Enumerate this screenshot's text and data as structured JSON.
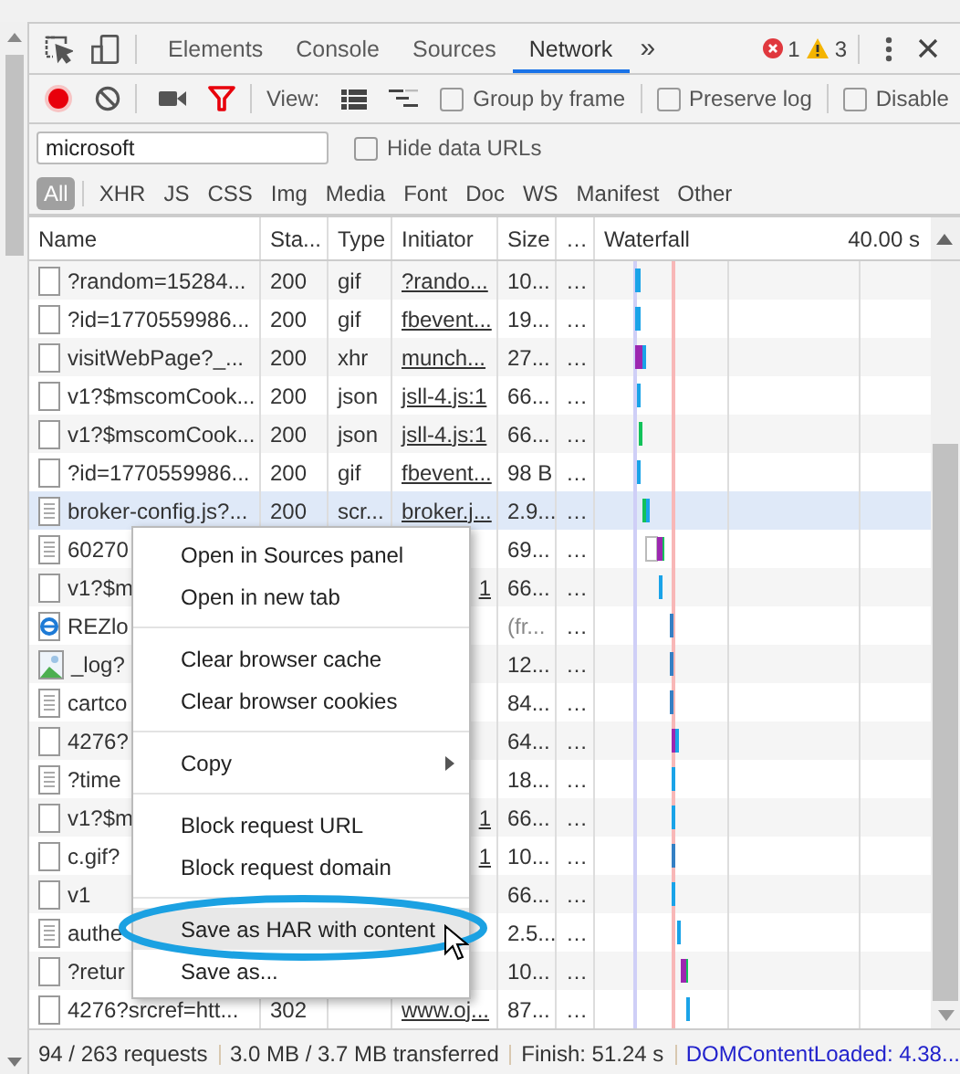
{
  "tabs": [
    {
      "label": "Elements",
      "selected": false
    },
    {
      "label": "Console",
      "selected": false
    },
    {
      "label": "Sources",
      "selected": false
    },
    {
      "label": "Network",
      "selected": true
    }
  ],
  "more_tabs": "»",
  "error_count": "1",
  "warning_count": "3",
  "network_toolbar": {
    "recording": true,
    "filter_active": true,
    "view_label": "View:",
    "checkboxes": [
      {
        "label": "Group by frame",
        "checked": false
      },
      {
        "label": "Preserve log",
        "checked": false
      },
      {
        "label": "Disable",
        "checked": false
      }
    ]
  },
  "filter": {
    "value": "microsoft",
    "hide_data_urls": {
      "label": "Hide data URLs",
      "checked": false
    }
  },
  "type_filters": [
    {
      "label": "All",
      "selected": true
    },
    {
      "label": "XHR",
      "selected": false
    },
    {
      "label": "JS",
      "selected": false
    },
    {
      "label": "CSS",
      "selected": false
    },
    {
      "label": "Img",
      "selected": false
    },
    {
      "label": "Media",
      "selected": false
    },
    {
      "label": "Font",
      "selected": false
    },
    {
      "label": "Doc",
      "selected": false
    },
    {
      "label": "WS",
      "selected": false
    },
    {
      "label": "Manifest",
      "selected": false
    },
    {
      "label": "Other",
      "selected": false
    }
  ],
  "table": {
    "columns": [
      "Name",
      "Sta...",
      "Type",
      "Initiator",
      "Size",
      "…",
      "Waterfall"
    ],
    "timeline_label": "40.00 s",
    "rows": [
      {
        "kind": "blank",
        "name": "?random=15284...",
        "status": "200",
        "type": "gif",
        "initiator": "?rando...",
        "size": "10...",
        "more": "…",
        "selected": false
      },
      {
        "kind": "blank",
        "name": "?id=1770559986...",
        "status": "200",
        "type": "gif",
        "initiator": "fbevent...",
        "size": "19...",
        "more": "…",
        "selected": false
      },
      {
        "kind": "blank",
        "name": "visitWebPage?_...",
        "status": "200",
        "type": "xhr",
        "initiator": "munch...",
        "size": "27...",
        "more": "…",
        "selected": false
      },
      {
        "kind": "blank",
        "name": "v1?$mscomCook...",
        "status": "200",
        "type": "json",
        "initiator": "jsll-4.js:1",
        "size": "66...",
        "more": "…",
        "selected": false
      },
      {
        "kind": "blank",
        "name": "v1?$mscomCook...",
        "status": "200",
        "type": "json",
        "initiator": "jsll-4.js:1",
        "size": "66...",
        "more": "…",
        "selected": false
      },
      {
        "kind": "blank",
        "name": "?id=1770559986...",
        "status": "200",
        "type": "gif",
        "initiator": "fbevent...",
        "size": "98 B",
        "more": "…",
        "selected": false
      },
      {
        "kind": "script",
        "name": "broker-config.js?...",
        "status": "200",
        "type": "scr...",
        "initiator": "broker.j...",
        "size": "2.9...",
        "more": "…",
        "selected": true
      },
      {
        "kind": "script",
        "name": "60270",
        "size": "69...",
        "more": "…",
        "selected": false
      },
      {
        "kind": "blank",
        "name": "v1?$m",
        "initiator": "1",
        "size": "66...",
        "more": "…",
        "selected": false
      },
      {
        "kind": "web",
        "name": "REZlo",
        "size": "(fr...",
        "from_cache": true,
        "more": "…",
        "selected": false
      },
      {
        "kind": "image",
        "name": "_log?",
        "size": "12...",
        "more": "…",
        "selected": false
      },
      {
        "kind": "script",
        "name": "cartco",
        "size": "84...",
        "more": "…",
        "selected": false
      },
      {
        "kind": "blank",
        "name": "4276?",
        "size": "64...",
        "more": "…",
        "selected": false
      },
      {
        "kind": "script",
        "name": "?time",
        "size": "18...",
        "more": "…",
        "selected": false
      },
      {
        "kind": "blank",
        "name": "v1?$m",
        "initiator": "1",
        "size": "66...",
        "more": "…",
        "selected": false
      },
      {
        "kind": "blank",
        "name": "c.gif?",
        "initiator": "1",
        "size": "10...",
        "more": "…",
        "selected": false
      },
      {
        "kind": "blank",
        "name": "v1",
        "size": "66...",
        "more": "…",
        "selected": false
      },
      {
        "kind": "script",
        "name": "authe",
        "size": "2.5...",
        "more": "…",
        "selected": false
      },
      {
        "kind": "blank",
        "name": "?retur",
        "size": "10...",
        "more": "…",
        "selected": false
      },
      {
        "kind": "blank",
        "name": "4276?srcref=htt...",
        "status": "302",
        "initiator": "www.oj...",
        "size": "87...",
        "more": "…",
        "selected": false
      }
    ]
  },
  "context_menu": {
    "items": [
      {
        "kind": "item",
        "label": "Open in Sources panel",
        "highlighted": false,
        "circled": false
      },
      {
        "kind": "item",
        "label": "Open in new tab",
        "highlighted": false,
        "circled": false
      },
      {
        "kind": "separator"
      },
      {
        "kind": "item",
        "label": "Clear browser cache",
        "highlighted": false,
        "circled": false
      },
      {
        "kind": "item",
        "label": "Clear browser cookies",
        "highlighted": false,
        "circled": false
      },
      {
        "kind": "separator"
      },
      {
        "kind": "submenu",
        "label": "Copy",
        "highlighted": false,
        "circled": false
      },
      {
        "kind": "separator"
      },
      {
        "kind": "item",
        "label": "Block request URL",
        "highlighted": false,
        "circled": false
      },
      {
        "kind": "item",
        "label": "Block request domain",
        "highlighted": false,
        "circled": false
      },
      {
        "kind": "separator"
      },
      {
        "kind": "item",
        "label": "Save as HAR with content",
        "highlighted": true,
        "circled": true
      },
      {
        "kind": "item",
        "label": "Save as...",
        "highlighted": false,
        "circled": false
      }
    ]
  },
  "status_bar": {
    "requests": "94 / 263 requests",
    "transferred": "3.0 MB / 3.7 MB transferred",
    "finish": "Finish: 51.24 s",
    "dom_content_loaded": "DOMContentLoaded: 4.38..."
  }
}
